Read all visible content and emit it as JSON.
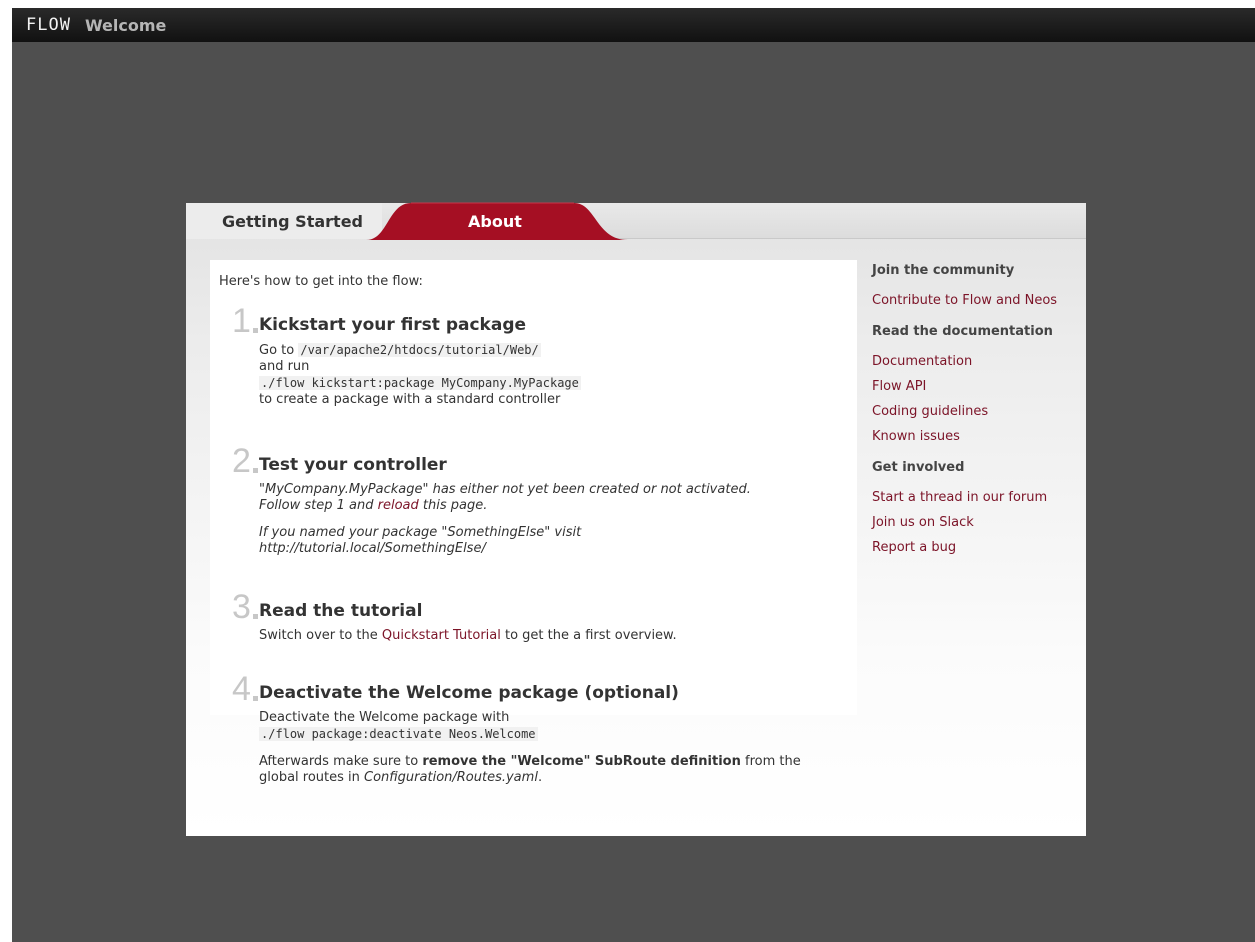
{
  "topbar": {
    "logo": "FLOW",
    "title": "Welcome"
  },
  "tabs": [
    {
      "label": "Getting Started",
      "active": true
    },
    {
      "label": "About",
      "active": false
    }
  ],
  "main": {
    "intro": "Here's how to get into the flow:",
    "steps": [
      {
        "number": "1",
        "title": "Kickstart your first package",
        "text_go_to": "Go to ",
        "path": "/var/apache2/htdocs/tutorial/Web/",
        "text_and_run": "and run",
        "command": "./flow kickstart:package MyCompany.MyPackage",
        "text_after": "to create a package with a standard controller"
      },
      {
        "number": "2",
        "title": "Test your controller",
        "line1": "\"MyCompany.MyPackage\" has either not yet been created or not activated.",
        "line2_pre": "Follow step 1 and ",
        "reload_link": "reload",
        "line2_post": " this page.",
        "line3": "If you named your package \"SomethingElse\" visit",
        "line4": "http://tutorial.local/SomethingElse/"
      },
      {
        "number": "3",
        "title": "Read the tutorial",
        "text_pre": "Switch over to the ",
        "link": "Quickstart Tutorial",
        "text_post": " to get the a first overview."
      },
      {
        "number": "4",
        "title": "Deactivate the Welcome package (optional)",
        "line1": "Deactivate the Welcome package with",
        "command": "./flow package:deactivate Neos.Welcome",
        "line2_pre": "Afterwards make sure to ",
        "line2_bold": "remove the \"Welcome\" SubRoute definition",
        "line2_post": " from the",
        "line3_pre": "global routes in ",
        "line3_italic": "Configuration/Routes.yaml",
        "line3_post": "."
      }
    ]
  },
  "sidebar": {
    "community_heading": "Join the community",
    "community_links": [
      "Contribute to Flow and Neos"
    ],
    "docs_heading": "Read the documentation",
    "docs_links": [
      "Documentation",
      "Flow API",
      "Coding guidelines",
      "Known issues"
    ],
    "involved_heading": "Get involved",
    "involved_links": [
      "Start a thread in our forum",
      "Join us on Slack",
      "Report a bug"
    ]
  },
  "colors": {
    "accent": "#a50f23",
    "link": "#7c1428",
    "background": "#4f4f4f",
    "topbar": "#1a1a1a"
  }
}
